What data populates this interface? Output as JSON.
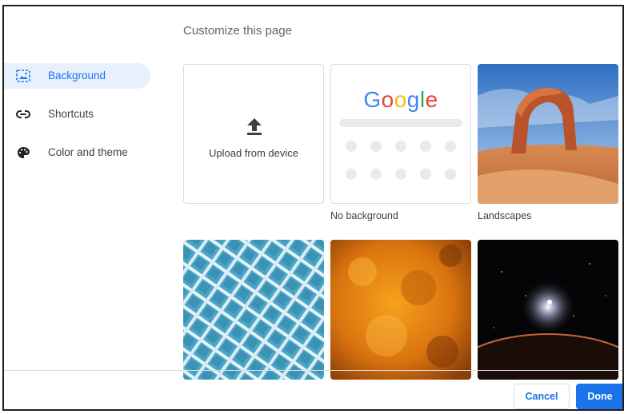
{
  "dialog": {
    "title": "Customize this page"
  },
  "sidebar": {
    "items": [
      {
        "label": "Background",
        "icon": "image-icon",
        "active": true
      },
      {
        "label": "Shortcuts",
        "icon": "link-icon",
        "active": false
      },
      {
        "label": "Color and theme",
        "icon": "palette-icon",
        "active": false
      }
    ]
  },
  "tiles": {
    "upload": {
      "label": "Upload from device",
      "icon": "upload-icon"
    },
    "no_background": {
      "caption": "No background",
      "logo_text": "Google"
    },
    "landscapes": {
      "caption": "Landscapes"
    }
  },
  "footer": {
    "cancel_label": "Cancel",
    "done_label": "Done"
  },
  "colors": {
    "accent": "#1a73e8",
    "active_bg": "#e8f0fe"
  }
}
